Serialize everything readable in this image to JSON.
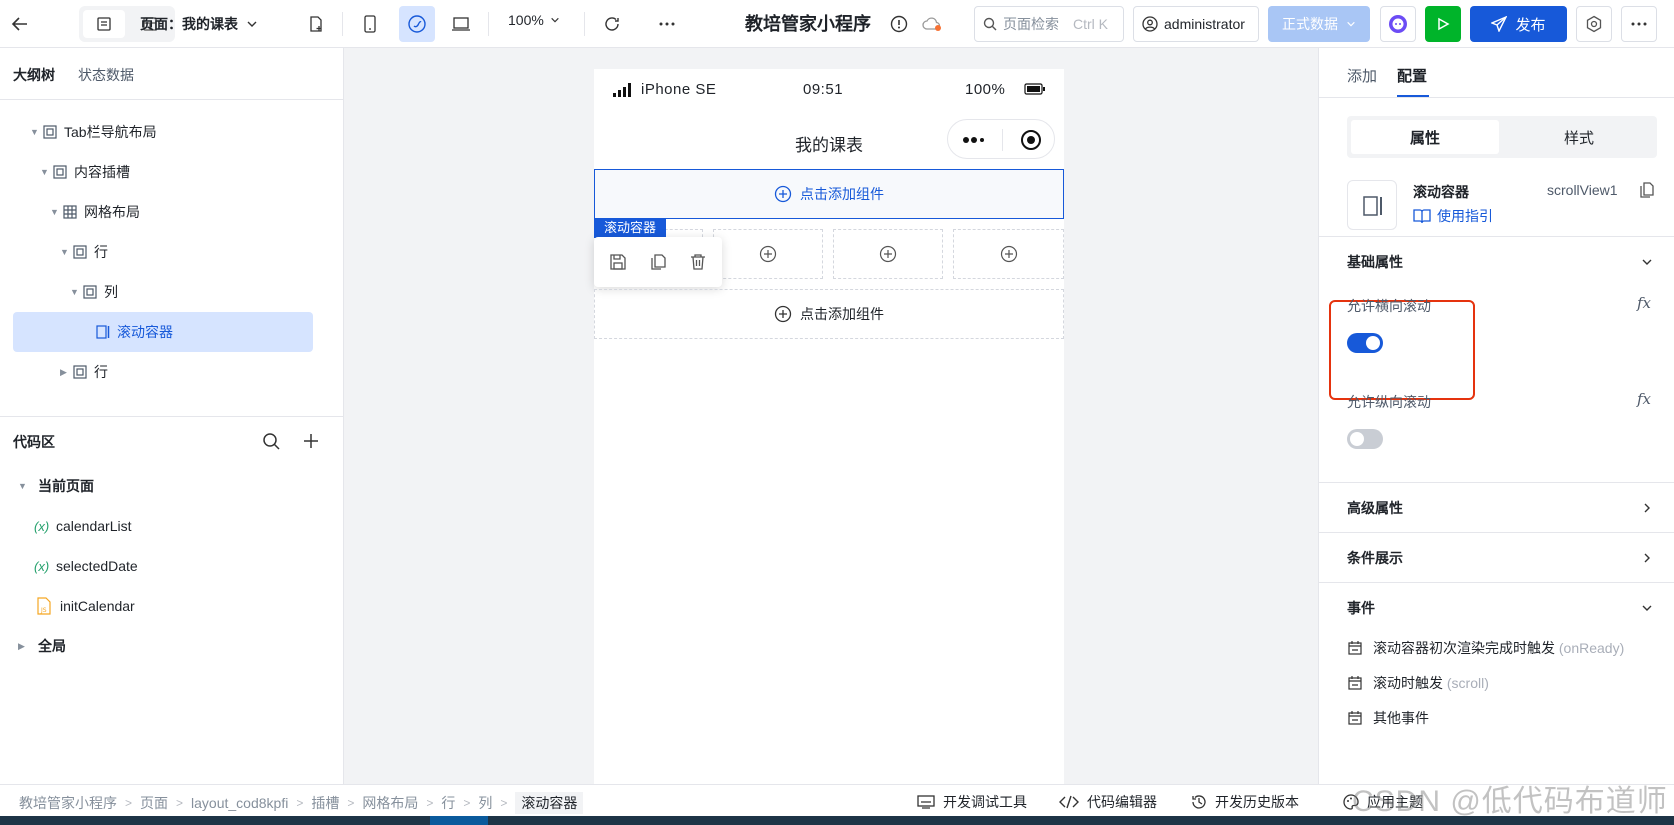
{
  "topbar": {
    "page_prefix": "页面：",
    "page_name": "我的课表",
    "zoom": "100%",
    "app_title": "教培管家小程序",
    "search_placeholder": "页面检索",
    "search_shortcut": "Ctrl K",
    "user": "administrator",
    "env": "正式数据",
    "publish": "发布"
  },
  "left": {
    "tabs": [
      "大纲树",
      "状态数据"
    ],
    "tree": [
      {
        "label": "Tab栏导航布局",
        "icon": "frame-icon"
      },
      {
        "label": "内容插槽",
        "icon": "frame-icon"
      },
      {
        "label": "网格布局",
        "icon": "grid-icon"
      },
      {
        "label": "行",
        "icon": "frame-icon"
      },
      {
        "label": "列",
        "icon": "frame-icon"
      },
      {
        "label": "滚动容器",
        "icon": "scroll-icon"
      },
      {
        "label": "行",
        "icon": "frame-icon"
      }
    ],
    "code_title": "代码区",
    "current_page": "当前页面",
    "code_items": [
      {
        "label": "calendarList",
        "type": "variable"
      },
      {
        "label": "selectedDate",
        "type": "variable"
      },
      {
        "label": "initCalendar",
        "type": "js-function"
      }
    ],
    "global": "全局"
  },
  "phone": {
    "device": "iPhone SE",
    "time": "09:51",
    "battery": "100%",
    "nav_title": "我的课表",
    "add_component": "点击添加组件",
    "selected_label": "滚动容器"
  },
  "right": {
    "tabs": [
      "添加",
      "配置"
    ],
    "segments": [
      "属性",
      "样式"
    ],
    "component_name": "滚动容器",
    "component_id": "scrollView1",
    "guide": "使用指引",
    "basic_props": "基础属性",
    "horizontal_scroll_label": "允许横向滚动",
    "horizontal_scroll": true,
    "vertical_scroll_label": "允许纵向滚动",
    "vertical_scroll": false,
    "advanced": "高级属性",
    "condition": "条件展示",
    "events_title": "事件",
    "events": [
      {
        "label": "滚动容器初次渲染完成时触发",
        "code": "(onReady)"
      },
      {
        "label": "滚动时触发",
        "code": "(scroll)"
      },
      {
        "label": "其他事件",
        "code": ""
      }
    ],
    "fx": "fx"
  },
  "bottom": {
    "breadcrumb": [
      "教培管家小程序",
      "页面",
      "layout_cod8kpfi",
      "插槽",
      "网格布局",
      "行",
      "列",
      "滚动容器"
    ],
    "tools": [
      "开发调试工具",
      "代码编辑器",
      "开发历史版本",
      "应用主题"
    ]
  },
  "watermark": "CSDN @低代码布道师",
  "colors": {
    "accent": "#1759d9",
    "run": "#00b42a",
    "highlight": "#e5330e",
    "selected_bg": "#d6e4ff"
  }
}
